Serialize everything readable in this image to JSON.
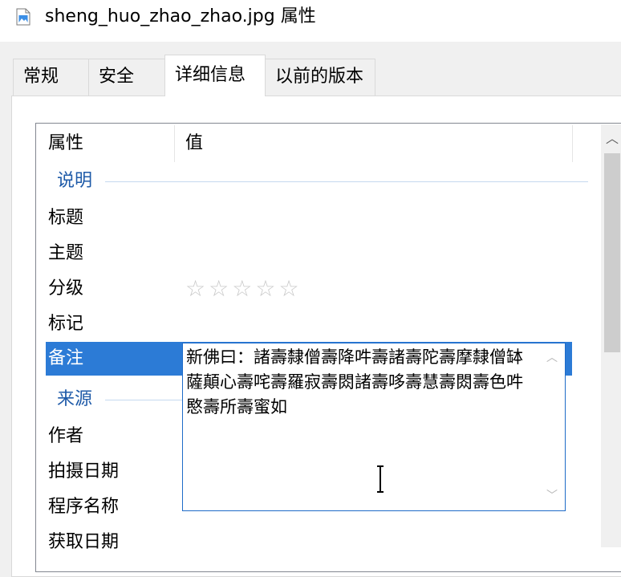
{
  "window": {
    "title": "sheng_huo_zhao_zhao.jpg 属性",
    "icon": "image-file-icon"
  },
  "tabs": [
    {
      "label": "常规"
    },
    {
      "label": "安全"
    },
    {
      "label": "详细信息",
      "active": true
    },
    {
      "label": "以前的版本"
    }
  ],
  "list": {
    "columns": {
      "property": "属性",
      "value": "值"
    },
    "groups": {
      "description": "说明",
      "origin": "来源"
    },
    "properties": {
      "title": "标题",
      "subject": "主题",
      "rating": "分级",
      "tags": "标记",
      "comments": "备注",
      "authors": "作者",
      "date_taken": "拍摄日期",
      "program_name": "程序名称",
      "date_acquired": "获取日期"
    },
    "rating": {
      "stars_filled": 0,
      "stars_total": 5,
      "star_glyph": "☆"
    },
    "comments_value": "新佛曰：諸壽隸僧壽降吽壽諸壽陀壽摩隸僧缽薩顛心壽咤壽羅寂壽閦諸壽哆壽慧壽閦壽色吽愍壽所壽蜜如",
    "selected_property": "comments"
  },
  "colors": {
    "selection": "#2c7bd6",
    "group_label": "#1e5aa8",
    "editor_border": "#1e6bc8"
  }
}
